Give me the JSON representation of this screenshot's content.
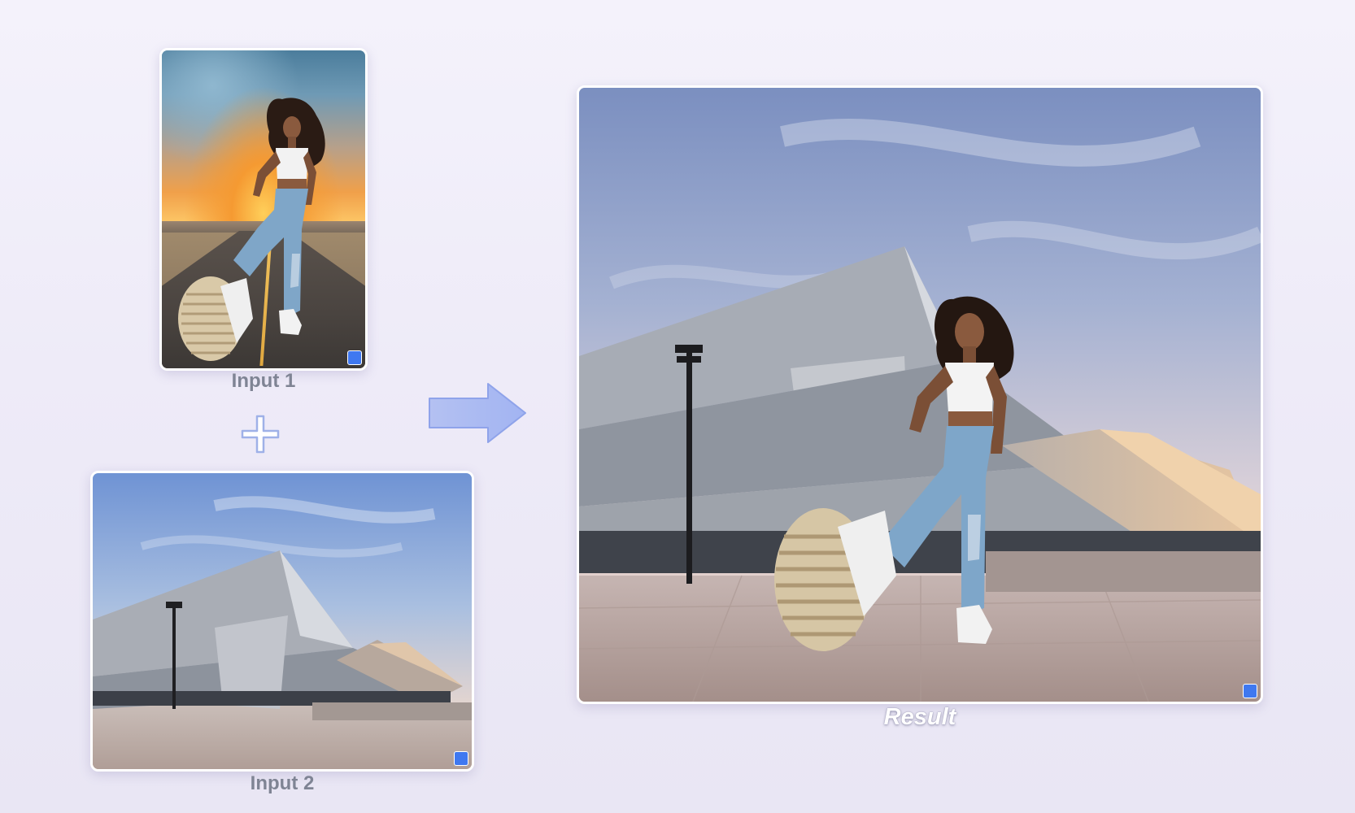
{
  "inputs": {
    "input1": {
      "label": "Input 1",
      "scene": "person-on-road-at-sunset"
    },
    "input2": {
      "label": "Input 2",
      "scene": "angular-building-plaza"
    }
  },
  "result": {
    "label": "Result",
    "scene": "person-composited-in-front-of-building"
  },
  "icons": {
    "plus": "plus-icon",
    "arrow": "arrow-right-icon",
    "badge": "generated-badge-icon"
  },
  "colors": {
    "background": "#eeebf8",
    "caption_text": "#7f8494",
    "result_caption": "#ffffff",
    "accent_plus": "#9fb1e8",
    "accent_arrow": "#a7b8f3",
    "badge": "#3f78f0"
  }
}
